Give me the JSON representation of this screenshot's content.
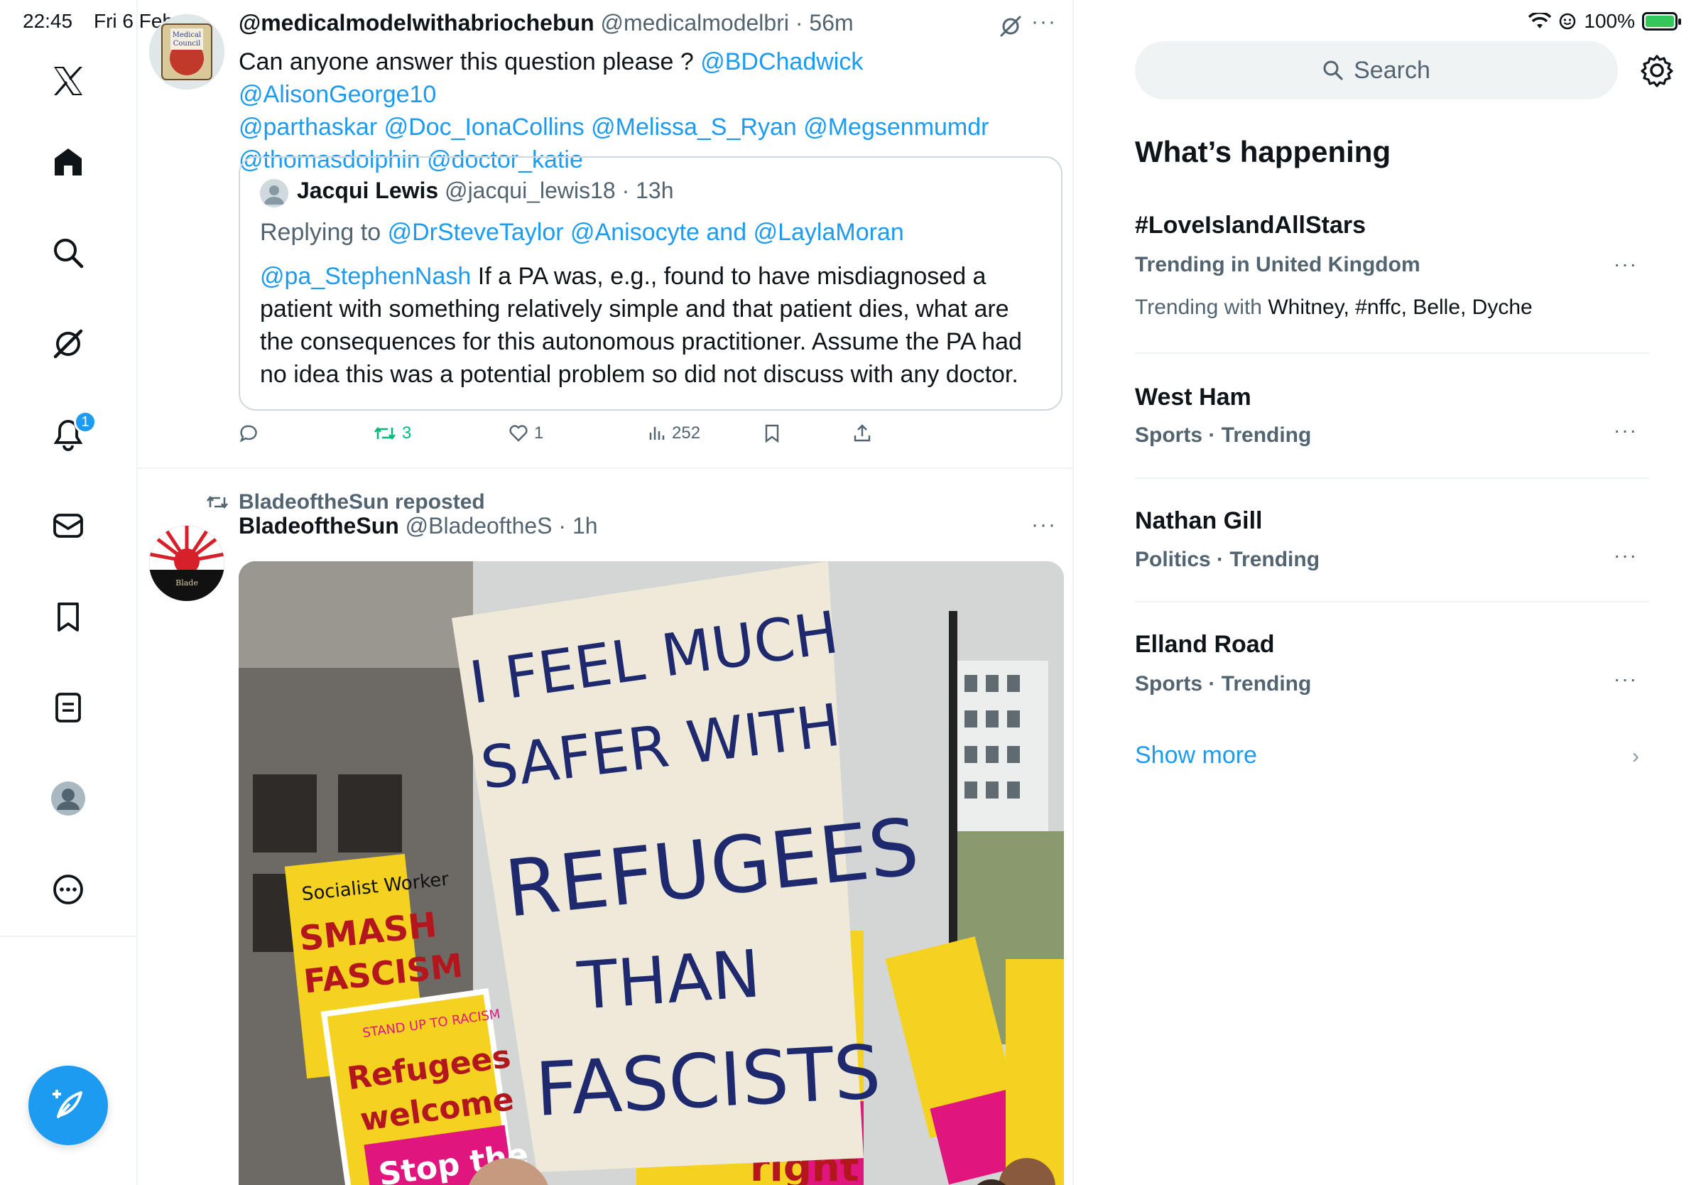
{
  "status_bar": {
    "time": "22:45",
    "date": "Fri 6 Feb",
    "battery": "100%"
  },
  "nav": {
    "notifications_badge": "1",
    "icons": [
      "x-logo-icon",
      "home-icon",
      "search-icon",
      "grok-icon",
      "notifications-icon",
      "messages-icon",
      "bookmarks-icon",
      "lists-icon",
      "profile-icon",
      "more-icon"
    ]
  },
  "tweet1": {
    "display_name": "@medicalmodelwithabriochebun",
    "handle": "@medicalmodelbri",
    "time": "· 56m",
    "text_lead": "Can anyone answer this question please ?",
    "mentions_line1": "@BDChadwick @AlisonGeorge10",
    "mentions_line2": "@parthaskar @Doc_IonaCollins @Melissa_S_Ryan @Megsenmumdr",
    "mentions_line3": "@thomasdolphin @doctor_katie",
    "more": "···",
    "quote": {
      "display_name": "Jacqui Lewis",
      "handle": "@jacqui_lewis18",
      "time": "· 13h",
      "replying_label": "Replying to",
      "replying_to": "@DrSteveTaylor @Anisocyte and @LaylaMoran",
      "mention": "@pa_StephenNash",
      "text": "If a PA was, e.g., found to have misdiagnosed a patient with something relatively simple and that patient dies, what are the consequences for this autonomous practitioner. Assume the PA had no idea this was a potential problem so did not discuss with any doctor."
    },
    "actions": {
      "replies": "",
      "reposts": "3",
      "likes": "1",
      "views": "252"
    }
  },
  "tweet2": {
    "reposted_by": "BladeoftheSun reposted",
    "display_name": "BladeoftheSun",
    "handle": "@BladeoftheS",
    "time": "· 1h",
    "more": "···",
    "image_sign": {
      "line1": "I FEEL MUCH",
      "line2": "SAFER WITH",
      "line3": "REFUGEES",
      "line4": "THAN",
      "line5": "FASCISTS"
    },
    "placards": {
      "smash": "SMASH",
      "fascism": "FASCISM",
      "socialist_worker": "Socialist Worker",
      "stand_up": "STAND UP TO RACISM",
      "refugees": "Refugees",
      "welcome": "welcome",
      "stop_the": "Stop the",
      "right": "right"
    }
  },
  "sidebar": {
    "search_placeholder": "Search",
    "whats_happening": "What’s happening",
    "trends": [
      {
        "title": "#LoveIslandAllStars",
        "meta": "Trending in United Kingdom",
        "with_label": "Trending with",
        "with_names": "Whitney, #nffc, Belle, Dyche"
      },
      {
        "title": "West Ham",
        "meta": "Sports · Trending"
      },
      {
        "title": "Nathan Gill",
        "meta": "Politics · Trending"
      },
      {
        "title": "Elland Road",
        "meta": "Sports · Trending"
      }
    ],
    "show_more": "Show more",
    "more": "···"
  },
  "colors": {
    "accent": "#1d9bf0",
    "repost_green": "#00ba7c",
    "secondary_text": "#536471",
    "divider": "#eff3f4"
  }
}
